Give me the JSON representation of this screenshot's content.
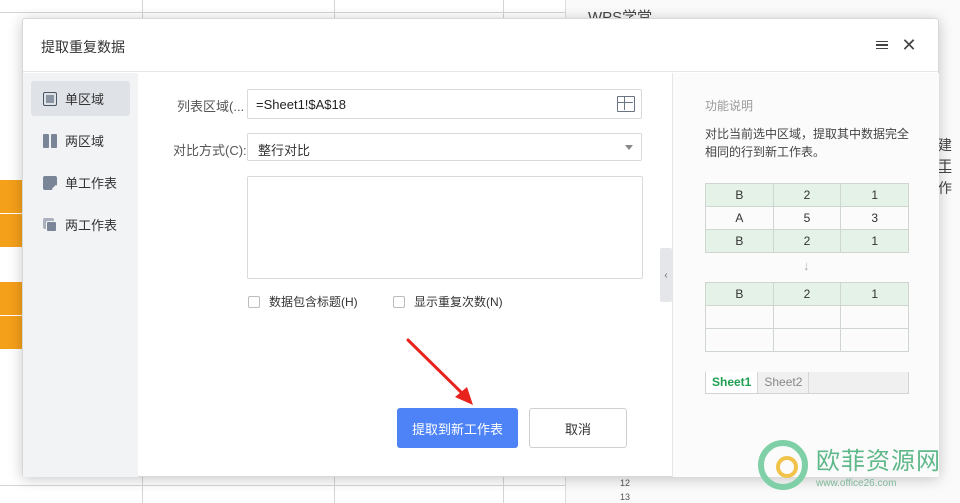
{
  "background": {
    "panel_title": "WPS学堂",
    "panel_side_text": [
      "建工",
      "工作"
    ],
    "row_numbers": [
      "12",
      "13"
    ]
  },
  "dialog": {
    "title": "提取重复数据",
    "sidebar": {
      "items": [
        {
          "label": "单区域",
          "icon": "single-range-icon",
          "active": true
        },
        {
          "label": "两区域",
          "icon": "two-ranges-icon",
          "active": false
        },
        {
          "label": "单工作表",
          "icon": "single-sheet-icon",
          "active": false
        },
        {
          "label": "两工作表",
          "icon": "two-sheets-icon",
          "active": false
        }
      ]
    },
    "form": {
      "range_label": "列表区域(...",
      "range_value": "=Sheet1!$A$18",
      "compare_label": "对比方式(C):",
      "compare_value": "整行对比",
      "checkbox_header": "数据包含标题(H)",
      "checkbox_count": "显示重复次数(N)"
    },
    "buttons": {
      "extract": "提取到新工作表",
      "cancel": "取消"
    },
    "help": {
      "title": "功能说明",
      "description": "对比当前选中区域，提取其中数据完全相同的行到新工作表。",
      "table_before": [
        [
          "B",
          "2",
          "1"
        ],
        [
          "A",
          "5",
          "3"
        ],
        [
          "B",
          "2",
          "1"
        ]
      ],
      "table_after": [
        [
          "B",
          "2",
          "1"
        ],
        [
          "",
          "",
          ""
        ],
        [
          "",
          "",
          ""
        ]
      ],
      "sheet_tabs": [
        "Sheet1",
        "Sheet2"
      ],
      "arrow": "↓"
    }
  },
  "watermark": {
    "text": "欧菲资源网",
    "url": "www.office26.com"
  }
}
